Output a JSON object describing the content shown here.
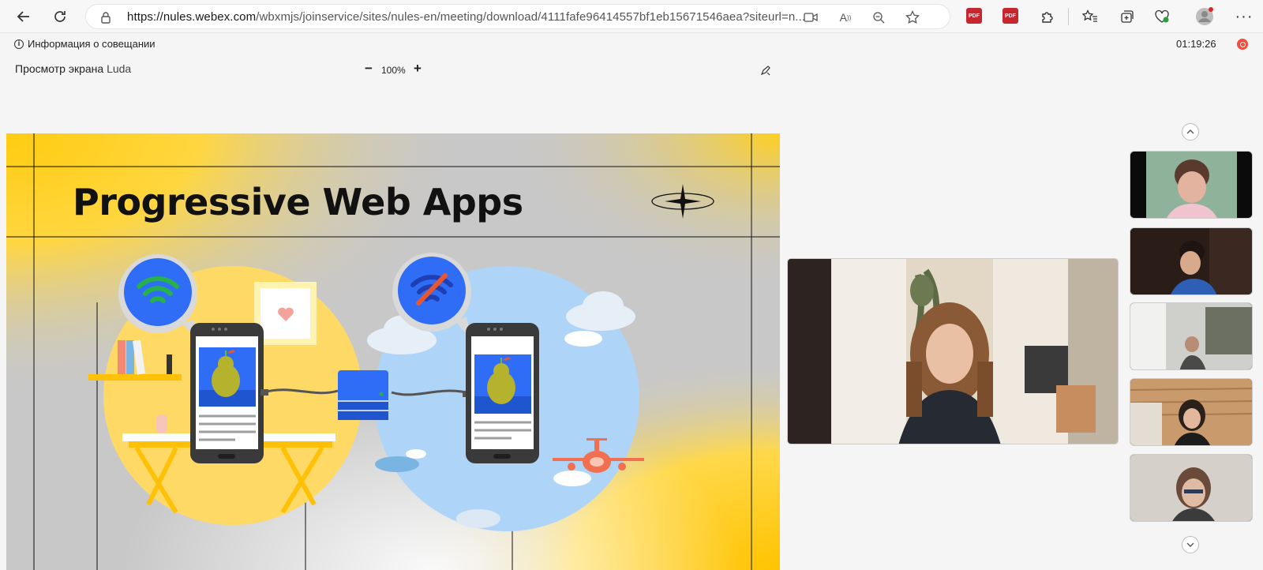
{
  "browser": {
    "url_domain": "https://nules.webex.com",
    "url_rest": "/wbxmjs/joinservice/sites/nules-en/meeting/download/4111fafe96414557bf1eb15671546aea?siteurl=n...",
    "ext_pdf1": "PDF",
    "ext_pdf2": "PDF"
  },
  "meeting": {
    "info_label": "Информация о совещании",
    "timer": "01:19:26",
    "screen_label": "Просмотр экрана ",
    "presenter": "Luda",
    "zoom_minus": "−",
    "zoom_level": "100%",
    "zoom_plus": "+"
  },
  "slide": {
    "title": "Progressive Web Apps"
  },
  "colors": {
    "slide_yellow": "#ffc90e",
    "slide_gray": "#c8c8c8",
    "wifi_blue": "#2f6df6",
    "pear_green": "#b5b32d",
    "record_red": "#f04e3e"
  }
}
